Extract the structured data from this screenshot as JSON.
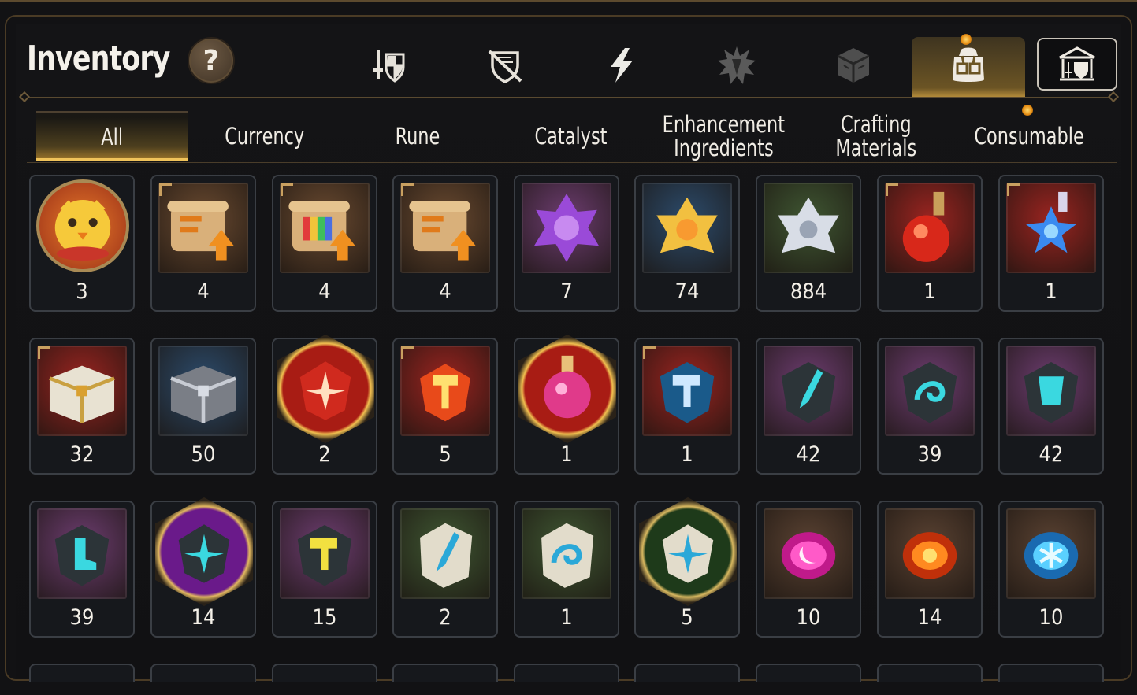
{
  "header": {
    "title": "Inventory",
    "help_label": "?",
    "category_icons": [
      {
        "name": "equipment-icon",
        "active": false
      },
      {
        "name": "no-equipment-icon",
        "active": false
      },
      {
        "name": "lightning-icon",
        "active": false
      },
      {
        "name": "burst-icon",
        "active": false
      },
      {
        "name": "cube-icon",
        "active": false
      },
      {
        "name": "bag-icon",
        "active": true
      }
    ],
    "guild_icon": "guild-icon"
  },
  "tabs": [
    {
      "label": "All",
      "active": true
    },
    {
      "label": "Currency",
      "active": false
    },
    {
      "label": "Rune",
      "active": false
    },
    {
      "label": "Catalyst",
      "active": false
    },
    {
      "label": "Enhancement\nIngredients",
      "active": false
    },
    {
      "label": "Crafting\nMaterials",
      "active": false
    },
    {
      "label": "Consumable",
      "active": false
    }
  ],
  "colors": {
    "accent_gold": "#f0c35a",
    "frame_bronze": "#5c4a2e",
    "notify_orange": "#f29a1a"
  },
  "items": [
    [
      {
        "icon": "chick-emblem-icon",
        "count": "3",
        "bg": "round"
      },
      {
        "icon": "scroll-upgrade-icon",
        "count": "4",
        "bg": "#6a4a30"
      },
      {
        "icon": "rainbow-scroll-icon",
        "count": "4",
        "bg": "#6a4a30"
      },
      {
        "icon": "scroll-upgrade-icon",
        "count": "4",
        "bg": "#6a4a30"
      },
      {
        "icon": "purple-crystal-icon",
        "count": "7",
        "bg": "#6d3d70"
      },
      {
        "icon": "gold-crystal-icon",
        "count": "74",
        "bg": "#2c4b6b"
      },
      {
        "icon": "silver-crystal-icon",
        "count": "884",
        "bg": "#3f5632"
      },
      {
        "icon": "red-potion-icon",
        "count": "1",
        "bg": "#9a2420"
      },
      {
        "icon": "star-potion-icon",
        "count": "1",
        "bg": "#9a2420"
      }
    ],
    [
      {
        "icon": "gold-chest-icon",
        "count": "32",
        "bg": "#9a2420"
      },
      {
        "icon": "silver-chest-icon",
        "count": "50",
        "bg": "#2c4b6b"
      },
      {
        "icon": "red-rune-icon",
        "count": "2",
        "bg": "hex-red"
      },
      {
        "icon": "hammer-rune-icon",
        "count": "5",
        "bg": "#9a2420"
      },
      {
        "icon": "pink-potion-icon",
        "count": "1",
        "bg": "hex-red"
      },
      {
        "icon": "blue-hammer-icon",
        "count": "1",
        "bg": "#9a2420"
      },
      {
        "icon": "sword-stone-icon",
        "count": "42",
        "bg": "#6d3d70"
      },
      {
        "icon": "swirl-stone-icon",
        "count": "39",
        "bg": "#6d3d70"
      },
      {
        "icon": "armor-stone-icon",
        "count": "42",
        "bg": "#6d3d70"
      }
    ],
    [
      {
        "icon": "boot-stone-icon",
        "count": "39",
        "bg": "#6d3d70"
      },
      {
        "icon": "star-stone-icon",
        "count": "14",
        "bg": "hex-purple"
      },
      {
        "icon": "gold-hammer-stone-icon",
        "count": "15",
        "bg": "#6d3d70"
      },
      {
        "icon": "sword-rock-icon",
        "count": "2",
        "bg": "#3f5632"
      },
      {
        "icon": "swirl-rock-icon",
        "count": "1",
        "bg": "#3f5632"
      },
      {
        "icon": "star-rock-icon",
        "count": "5",
        "bg": "hex-green"
      },
      {
        "icon": "moon-gem-icon",
        "count": "10",
        "bg": "#5a4232"
      },
      {
        "icon": "sun-gem-icon",
        "count": "14",
        "bg": "#5a4232"
      },
      {
        "icon": "frost-gem-icon",
        "count": "10",
        "bg": "#5a4232"
      }
    ]
  ]
}
